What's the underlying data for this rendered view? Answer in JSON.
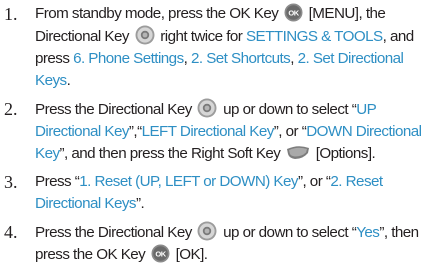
{
  "steps": [
    {
      "number": "1.",
      "t1": "From standby mode, press the OK Key",
      "ok_icon_label": "OK",
      "t2": "[MENU], the Directional Key",
      "t3": "right twice for",
      "m1": "SETTINGS & TOOLS",
      "t4": ", and press",
      "m2": "6. Phone Settings",
      "t5": ",",
      "m3": "2. Set Shortcuts",
      "t6": ",",
      "m4": "2. Set Directional Keys",
      "t7": "."
    },
    {
      "number": "2.",
      "t1": "Press the Directional Key",
      "t2": "up or down to select “",
      "m1": "UP Directional Key",
      "t3": "”,“",
      "m2": "LEFT Directional Key",
      "t4": "”, or “",
      "m3": "DOWN Directional Key",
      "t5": "”, and then press the Right Soft Key",
      "t6": "[Options]."
    },
    {
      "number": "3.",
      "t1": "Press “",
      "m1": "1. Reset (UP, LEFT or DOWN) Key",
      "t2": "”, or “",
      "m2": "2. Reset Directional Keys",
      "t3": "”."
    },
    {
      "number": "4.",
      "t1": "Press the Directional Key",
      "t2": "up or down to select “",
      "m1": "Yes",
      "t3": "”, then press the OK Key",
      "ok_icon_label": "OK",
      "t4": "[OK]."
    }
  ],
  "colors": {
    "menu_text": "#2e8fc4",
    "body_text": "#231f20"
  },
  "icons": {
    "ok_key": "ok-key-icon",
    "directional_key": "directional-key-icon",
    "right_soft_key": "right-soft-key-icon"
  }
}
